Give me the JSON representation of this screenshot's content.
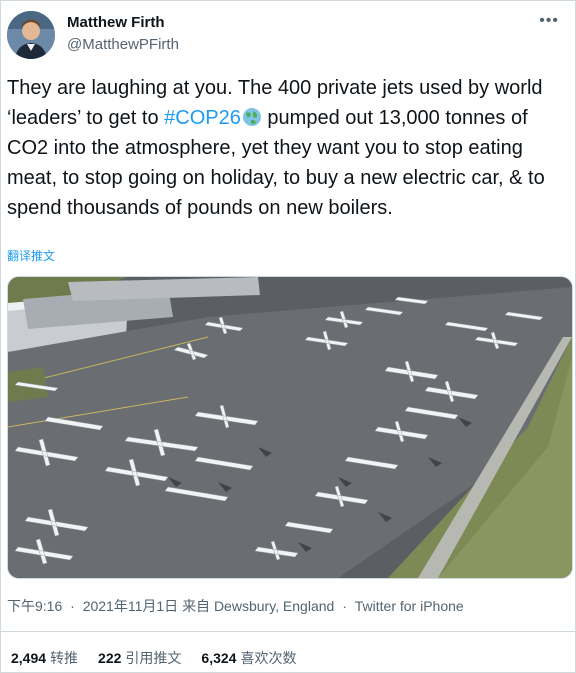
{
  "author": {
    "name": "Matthew Firth",
    "handle": "@MatthewPFirth"
  },
  "tweet": {
    "text_before_hashtag": "They are laughing at you. The 400 private jets used by world ‘leaders’ to get to ",
    "hashtag": "#COP26",
    "text_after_hashtag": " pumped out 13,000 tonnes of CO2 into the atmosphere, yet they want you to stop eating meat, to stop going on holiday, to buy a new electric car, & to spend thousands of pounds on new boilers.",
    "translate_label": "翻译推文"
  },
  "meta": {
    "time": "下午9:16",
    "date": "2021年11月1日",
    "location": "来自 Dewsbury, England",
    "source": "Twitter for iPhone"
  },
  "stats": {
    "retweets_count": "2,494",
    "retweets_label": "转推",
    "quotes_count": "222",
    "quotes_label": "引用推文",
    "likes_count": "6,324",
    "likes_label": "喜欢次数"
  },
  "icons": {
    "more": "more-options-icon",
    "hashtag_emoji": "globe-icon"
  },
  "colors": {
    "link": "#1d9bf0",
    "secondary_text": "#536471",
    "primary_text": "#0f1419",
    "border": "#cfd9de"
  }
}
